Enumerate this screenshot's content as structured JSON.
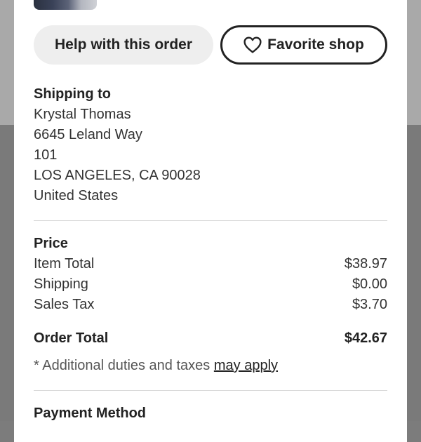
{
  "buttons": {
    "help_label": "Help with this order",
    "favorite_label": "Favorite shop"
  },
  "shipping": {
    "title": "Shipping to",
    "name": "Krystal Thomas",
    "street": "6645 Leland Way",
    "unit": "101",
    "city_state_zip": "LOS ANGELES, CA 90028",
    "country": "United States"
  },
  "price": {
    "title": "Price",
    "rows": [
      {
        "label": "Item Total",
        "value": "$38.97"
      },
      {
        "label": "Shipping",
        "value": "$0.00"
      },
      {
        "label": "Sales Tax",
        "value": "$3.70"
      }
    ],
    "total_label": "Order Total",
    "total_value": "$42.67",
    "note_prefix": "* Additional duties and taxes",
    "note_link": "may apply"
  },
  "payment": {
    "title": "Payment Method"
  },
  "icons": {
    "favorite": "heart-outline-icon"
  }
}
